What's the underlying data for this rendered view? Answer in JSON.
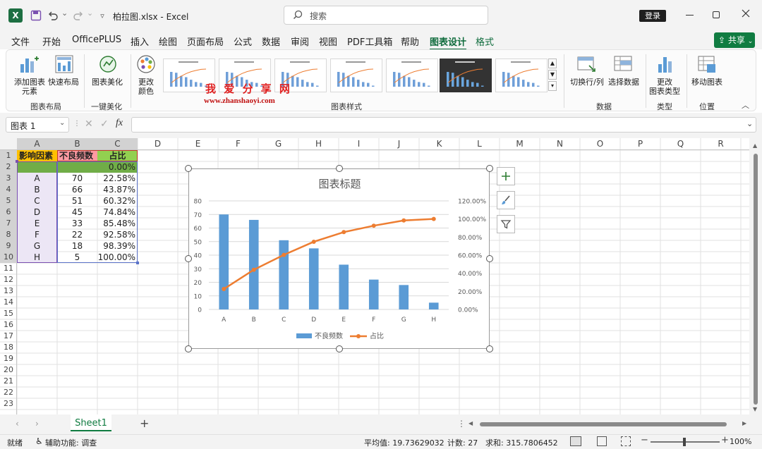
{
  "title_bar": {
    "undo_menu": "⌄",
    "redo_menu": "⌄",
    "title": "柏拉图.xlsx  -  Excel",
    "search_placeholder": "搜索",
    "login": "登录"
  },
  "menu_tabs": [
    "文件",
    "开始",
    "OfficePLUS",
    "插入",
    "绘图",
    "页面布局",
    "公式",
    "数据",
    "审阅",
    "视图",
    "PDF工具箱",
    "帮助",
    "图表设计",
    "格式"
  ],
  "share": "共享",
  "ribbon": {
    "add_element": "添加图表",
    "add_element2": "元素",
    "quick_layout": "快速布局",
    "group_layout": "图表布局",
    "beautify": "图表美化",
    "group_beautify": "一键美化",
    "change_color": "更改",
    "change_color2": "颜色",
    "group_styles": "图表样式",
    "switch_row_col": "切换行/列",
    "select_data": "选择数据",
    "group_data": "数据",
    "change_type": "更改",
    "change_type2": "图表类型",
    "group_type": "类型",
    "move_chart": "移动图表",
    "group_location": "位置",
    "watermark_cn": "我 爱 分 享 网",
    "watermark_url": "www.zhanshaoyi.com"
  },
  "formula_bar": {
    "name_box": "图表 1",
    "fx": "fx",
    "content": ""
  },
  "columns": [
    "A",
    "B",
    "C",
    "D",
    "E",
    "F",
    "G",
    "H",
    "I",
    "J",
    "K",
    "L",
    "M",
    "N",
    "O",
    "P",
    "Q",
    "R"
  ],
  "rows": [
    "1",
    "2",
    "3",
    "4",
    "5",
    "6",
    "7",
    "8",
    "9",
    "10",
    "11",
    "12",
    "13",
    "14",
    "15",
    "16",
    "17",
    "18",
    "19",
    "20",
    "21",
    "22",
    "23"
  ],
  "table": {
    "header": [
      "影响因素",
      "不良频数",
      "占比"
    ],
    "row2": [
      "",
      "",
      "0.00%"
    ],
    "data": [
      [
        "A",
        "70",
        "22.58%"
      ],
      [
        "B",
        "66",
        "43.87%"
      ],
      [
        "C",
        "51",
        "60.32%"
      ],
      [
        "D",
        "45",
        "74.84%"
      ],
      [
        "E",
        "33",
        "85.48%"
      ],
      [
        "F",
        "22",
        "92.58%"
      ],
      [
        "G",
        "18",
        "98.39%"
      ],
      [
        "H",
        "5",
        "100.00%"
      ]
    ]
  },
  "chart_data": {
    "type": "bar",
    "title": "图表标题",
    "categories": [
      "A",
      "B",
      "C",
      "D",
      "E",
      "F",
      "G",
      "H"
    ],
    "series": [
      {
        "name": "不良频数",
        "type": "bar",
        "axis": "primary",
        "color": "#5b9bd5",
        "values": [
          70,
          66,
          51,
          45,
          33,
          22,
          18,
          5
        ]
      },
      {
        "name": "占比",
        "type": "line",
        "axis": "secondary",
        "color": "#ed7d31",
        "values": [
          22.58,
          43.87,
          60.32,
          74.84,
          85.48,
          92.58,
          98.39,
          100.0
        ]
      }
    ],
    "ylim": [
      0,
      80
    ],
    "y_ticks": [
      "0",
      "10",
      "20",
      "30",
      "40",
      "50",
      "60",
      "70",
      "80"
    ],
    "y2lim": [
      0,
      120
    ],
    "y2_ticks": [
      "0.00%",
      "20.00%",
      "40.00%",
      "60.00%",
      "80.00%",
      "100.00%",
      "120.00%"
    ],
    "legend": "bottom",
    "grid": true
  },
  "sheet_tab": "Sheet1",
  "status": {
    "ready": "就绪",
    "accessibility": "辅助功能: 调查",
    "average": "平均值: 19.73629032",
    "count": "计数: 27",
    "sum": "求和: 315.7806452",
    "zoom": "100%"
  }
}
